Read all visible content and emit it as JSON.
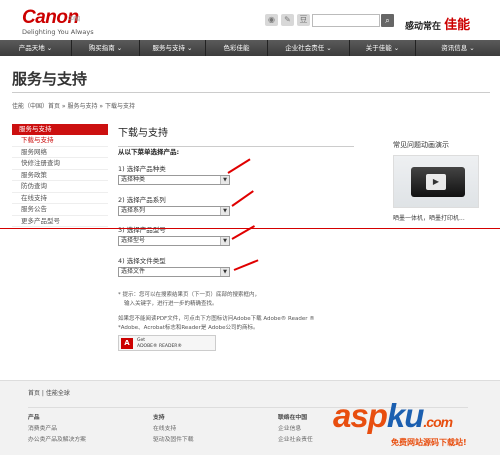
{
  "header": {
    "logo_text": "Canon",
    "region": "中国",
    "tagline": "Delighting You Always",
    "slogan_prefix": "感动常在",
    "slogan_brand": "佳能",
    "social_icons": [
      "weibo-icon",
      "share-icon",
      "douban-icon"
    ],
    "search_placeholder": ""
  },
  "nav": {
    "items": [
      "产品天地 ⌄",
      "购买指南 ⌄",
      "服务与支持 ⌄",
      "色彩佳能",
      "企业社会责任 ⌄",
      "关于佳能 ⌄",
      "资讯信息 ⌄"
    ]
  },
  "page": {
    "title": "服务与支持",
    "breadcrumb": "佳能（中国）首页 » 服务与支持 » 下载与支持"
  },
  "sidebar": {
    "head": "服务与支持",
    "items": [
      "下载与支持",
      "服务网络",
      "快修注册查询",
      "服务政策",
      "防伪查询",
      "在线支持",
      "服务公告",
      "更多产品型号"
    ]
  },
  "main": {
    "section_title": "下载与支持",
    "intro": "从以下菜单选择产品:",
    "steps": [
      {
        "label": "1) 选择产品种类",
        "value": "选择种类"
      },
      {
        "label": "2) 选择产品系列",
        "value": "选择系列"
      },
      {
        "label": "3) 选择产品型号",
        "value": "选择型号"
      },
      {
        "label": "4) 选择文件类型",
        "value": "选择文件"
      }
    ],
    "note1": "* 提示：您可以在搜索结果页（下一页）底部的搜索框内，",
    "note2": "输入关键字，进行进一步的精确查找。",
    "note3": "如果您不能阅读PDF文件，可点击下方图标访问Adobe下载 Adobe® Reader ®",
    "note4": "*Adobe、Acrobat标志和Reader是 Adobe公司的商标。",
    "adobe_line1": "Get",
    "adobe_line2": "ADOBE® READER®"
  },
  "faq": {
    "title": "常见问题动画演示",
    "caption": "晒墨一体机，晒墨打印机..."
  },
  "footer": {
    "links": "首页 | 佳能全球",
    "col1_head": "产品",
    "col1_items": [
      "消费类产品",
      "办公类产品及解决方案"
    ],
    "col2_head": "支持",
    "col2_items": [
      "在线支持",
      "驱动及固件下载"
    ],
    "col3_head": "联络在中国",
    "col3_items": [
      "企业信息",
      "企业社会责任"
    ]
  },
  "watermark": {
    "text_a": "asp",
    "text_b": "ku",
    "suffix": ".com",
    "sub": "免费网站源码下载站!"
  },
  "colors": {
    "brand_red": "#cc0000",
    "nav_bg": "#444444",
    "annotation_red": "#e00000"
  }
}
